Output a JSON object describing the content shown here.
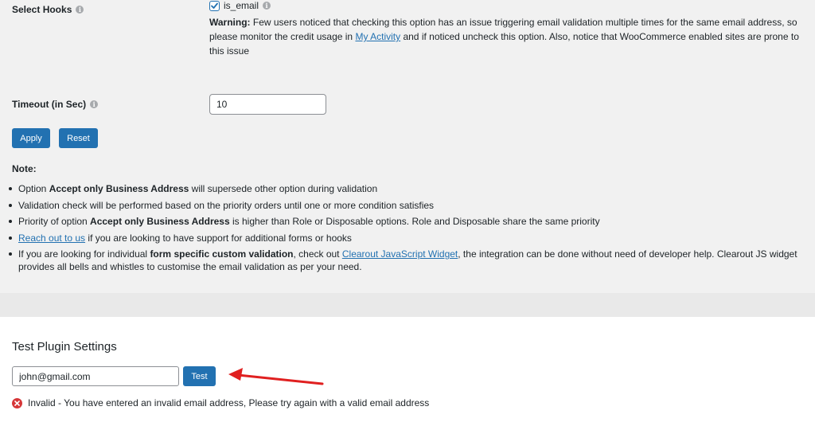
{
  "hooks": {
    "label": "Select Hooks",
    "checkbox_label": "is_email",
    "checked": true,
    "warning_bold": "Warning:",
    "warning_text_1": " Few users noticed that checking this option has an issue triggering email validation multiple times for the same email address, so please monitor the credit usage in ",
    "warning_link": "My Activity",
    "warning_text_2": " and if noticed uncheck this option. Also, notice that WooCommerce enabled sites are prone to this issue"
  },
  "timeout": {
    "label": "Timeout (in Sec)",
    "value": "10"
  },
  "actions": {
    "apply": "Apply",
    "reset": "Reset"
  },
  "notes": {
    "title": "Note:",
    "item1_a": "Option ",
    "item1_b": "Accept only Business Address",
    "item1_c": " will supersede other option during validation",
    "item2": "Validation check will be performed based on the priority orders until one or more condition satisfies",
    "item3_a": "Priority of option ",
    "item3_b": "Accept only Business Address",
    "item3_c": " is higher than Role or Disposable options. Role and Disposable share the same priority",
    "item4_link": "Reach out to us",
    "item4_text": " if you are looking to have support for additional forms or hooks",
    "item5_a": "If you are looking for individual ",
    "item5_b": "form specific custom validation",
    "item5_c": ", check out ",
    "item5_link": "Clearout JavaScript Widget",
    "item5_d": ", the integration can be done without need of developer help. Clearout JS widget provides all bells and whistles to customise the email validation as per your need."
  },
  "test": {
    "title": "Test Plugin Settings",
    "email_value": "john@gmail.com",
    "button": "Test",
    "result_text": "Invalid - You have entered an invalid email address, Please try again with a valid email address"
  },
  "colors": {
    "primary": "#2271b1",
    "error": "#d63638",
    "arrow": "#e02020"
  }
}
